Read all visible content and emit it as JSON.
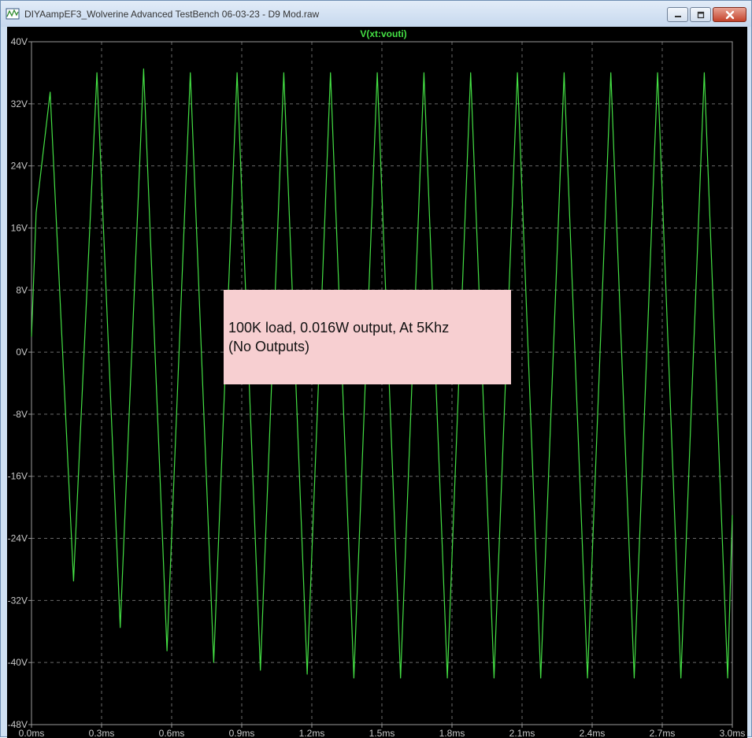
{
  "window": {
    "title": "DIYAampEF3_Wolverine Advanced TestBench 06-03-23 - D9 Mod.raw",
    "icon": "waveform-viewer-icon",
    "controls": [
      "minimize-icon",
      "maximize-icon",
      "close-icon"
    ]
  },
  "annotation": {
    "line1": "100K load, 0.016W output, At 5Khz",
    "line2": "(No Outputs)"
  },
  "colors": {
    "plot_background": "#000000",
    "trace": "#44e044",
    "grid": "#6a6a6a",
    "axis_text": "#c8c8c8",
    "annotation_bg": "#f7cfd1"
  },
  "chart_data": {
    "type": "line",
    "title": "V(xt:vouti)",
    "xlabel": "",
    "ylabel": "",
    "xlim": [
      0,
      3.0
    ],
    "ylim": [
      -48,
      40
    ],
    "x_ticks": [
      "0.0ms",
      "0.3ms",
      "0.6ms",
      "0.9ms",
      "1.2ms",
      "1.5ms",
      "1.8ms",
      "2.1ms",
      "2.4ms",
      "2.7ms",
      "3.0ms"
    ],
    "x_tick_values": [
      0,
      0.3,
      0.6,
      0.9,
      1.2,
      1.5,
      1.8,
      2.1,
      2.4,
      2.7,
      3.0
    ],
    "y_ticks": [
      "40V",
      "32V",
      "24V",
      "16V",
      "8V",
      "0V",
      "-8V",
      "-16V",
      "-24V",
      "-32V",
      "-40V",
      "-48V"
    ],
    "y_tick_values": [
      40,
      32,
      24,
      16,
      8,
      0,
      -8,
      -16,
      -24,
      -32,
      -40,
      -48
    ],
    "grid": true,
    "series": [
      {
        "name": "V(xt:vouti)",
        "x": [
          0.0,
          0.02,
          0.08,
          0.18,
          0.28,
          0.38,
          0.48,
          0.58,
          0.68,
          0.78,
          0.88,
          0.98,
          1.08,
          1.18,
          1.28,
          1.38,
          1.48,
          1.58,
          1.68,
          1.78,
          1.88,
          1.98,
          2.08,
          2.18,
          2.28,
          2.38,
          2.48,
          2.58,
          2.68,
          2.78,
          2.88,
          2.98,
          3.0
        ],
        "y": [
          2.0,
          18.0,
          33.5,
          -29.5,
          36.0,
          -35.5,
          36.5,
          -38.5,
          36.0,
          -40.0,
          36.0,
          -41.0,
          36.0,
          -41.5,
          36.0,
          -42.0,
          36.0,
          -42.0,
          36.0,
          -42.0,
          36.0,
          -42.0,
          36.0,
          -42.0,
          36.0,
          -42.0,
          36.0,
          -42.0,
          36.0,
          -42.0,
          36.0,
          -42.0,
          -21.0
        ]
      }
    ]
  }
}
